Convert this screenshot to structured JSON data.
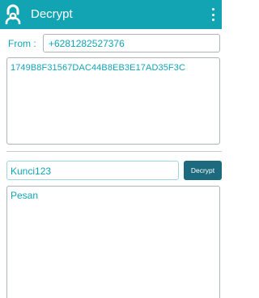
{
  "appbar": {
    "title": "Decrypt",
    "icon": "lock-person-icon",
    "menu_icon": "overflow-menu-icon",
    "color": "#12a4b3"
  },
  "form": {
    "from_label": "From :",
    "from_value": "+6281282527376",
    "ciphertext": "1749B8F31567DAC44B8EB3E17AD35F3C",
    "key_value": "Kunci123",
    "decrypt_label": "Decrypt",
    "message_placeholder": "Pesan"
  },
  "colors": {
    "accent": "#12a4b3",
    "button": "#1d6a7f"
  }
}
